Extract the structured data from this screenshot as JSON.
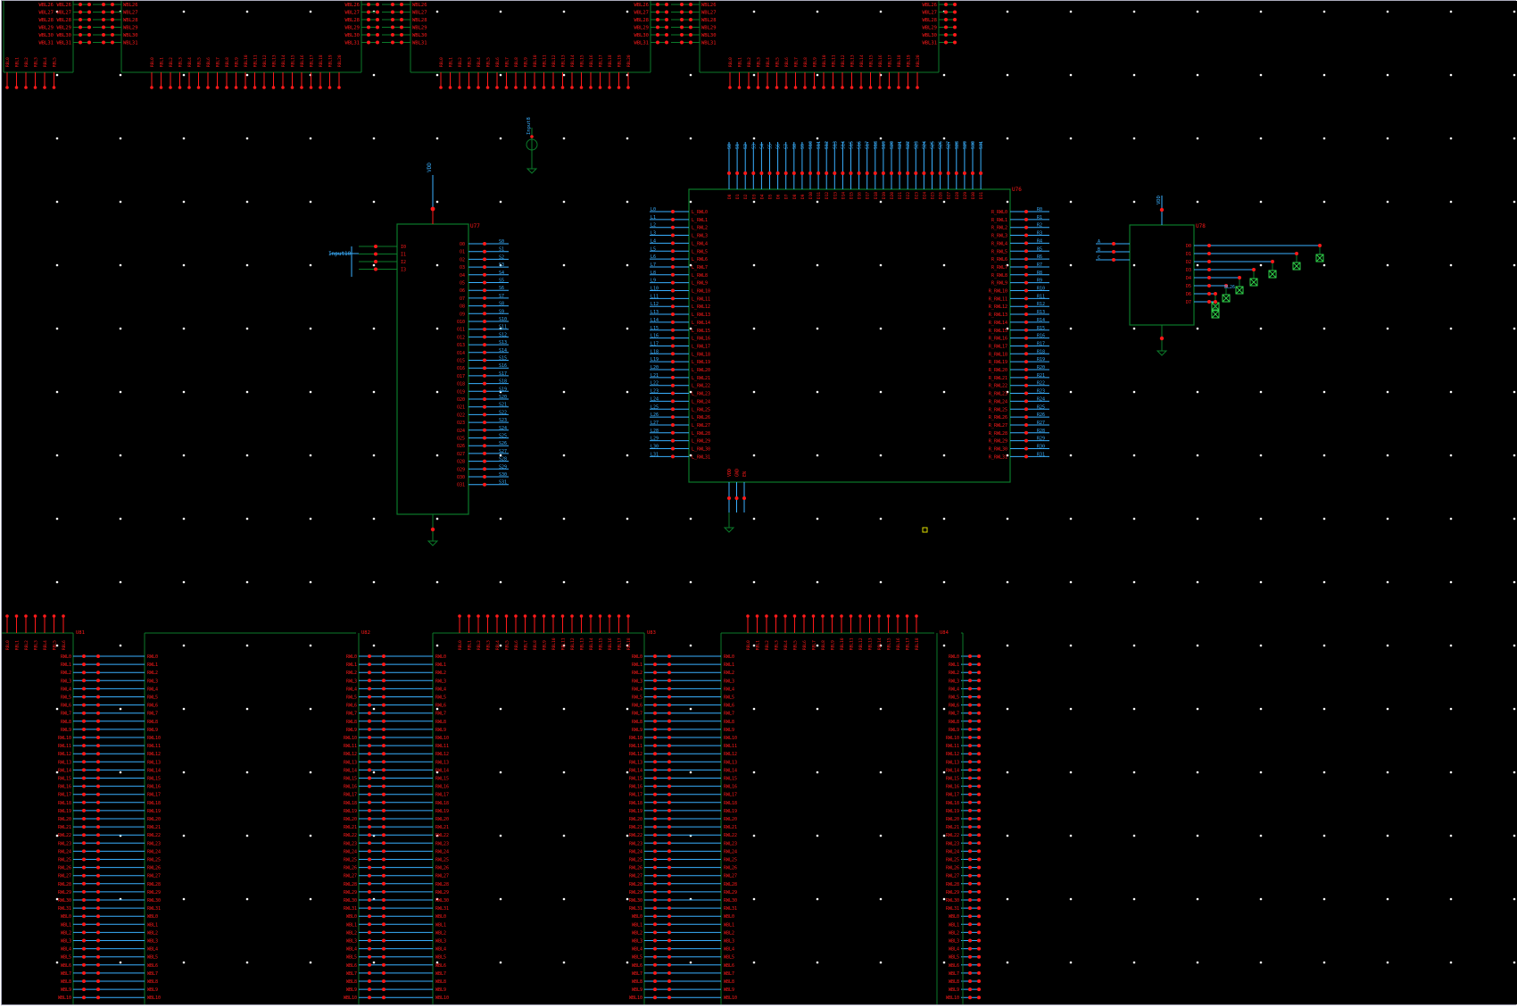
{
  "app": {
    "canvas": "schematic-editor-canvas",
    "background": "#000000"
  },
  "colors": {
    "wire": "#0b7a2a",
    "pin": "#ff1a1a",
    "net": "#3ab0ff",
    "grid": "#ffffff",
    "marker": "#e0e000"
  },
  "grid": {
    "cols": 25,
    "rows": 16
  },
  "top_blocks": [
    {
      "ref": "",
      "pins_left": [
        "WBL26",
        "WBL27",
        "WBL28",
        "WBL29",
        "WBL30",
        "WBL31"
      ],
      "pins_right": [
        "WBL26",
        "WBL27",
        "WBL28",
        "WBL29",
        "WBL30",
        "WBL31"
      ]
    },
    {
      "ref": "",
      "pins_left": [
        "WBL26",
        "WBL27",
        "WBL28",
        "WBL29",
        "WBL30",
        "WBL31"
      ],
      "pins_right": [
        "WBL26",
        "WBL27",
        "WBL28",
        "WBL29",
        "WBL30",
        "WBL31"
      ]
    },
    {
      "ref": "",
      "pins_left": [
        "WBL26",
        "WBL27",
        "WBL28",
        "WBL29",
        "WBL30",
        "WBL31"
      ],
      "pins_right": [
        "WBL26",
        "WBL27",
        "WBL28",
        "WBL29",
        "WBL30",
        "WBL31"
      ]
    },
    {
      "ref": "",
      "pins_left": [
        "WBL26",
        "WBL27",
        "WBL28",
        "WBL29",
        "WBL30",
        "WBL31"
      ],
      "pins_right": [
        "WBL26",
        "WBL27",
        "WBL28",
        "WBL29",
        "WBL30",
        "WBL31"
      ]
    }
  ],
  "u77": {
    "ref": "U77",
    "vdd_label": "VDD",
    "input_net": "Input10",
    "pins_left": [
      "I0",
      "I1",
      "I2",
      "I3"
    ],
    "pins_right": [
      "O0",
      "O1",
      "O2",
      "O3",
      "O4",
      "O5",
      "O6",
      "O7",
      "O8",
      "O9",
      "O10",
      "O11",
      "O12",
      "O13",
      "O14",
      "O15",
      "O16",
      "O17",
      "O18",
      "O19",
      "O20",
      "O21",
      "O22",
      "O23",
      "O24",
      "O25",
      "O26",
      "O27",
      "O28",
      "O29",
      "O30",
      "O31"
    ],
    "nets_right": [
      "S0",
      "S1",
      "S2",
      "S3",
      "S4",
      "S5",
      "S6",
      "S7",
      "S8",
      "S9",
      "S10",
      "S11",
      "S12",
      "S13",
      "S14",
      "S15",
      "S16",
      "S17",
      "S18",
      "S19",
      "S20",
      "S21",
      "S22",
      "S23",
      "S24",
      "S25",
      "S26",
      "S27",
      "S28",
      "S29",
      "S30",
      "S31"
    ],
    "gnd_label": "GND"
  },
  "input_source": {
    "label": "Input8"
  },
  "u76": {
    "ref": "U76",
    "top_nets": [
      "S0",
      "S1",
      "S2",
      "S3",
      "S4",
      "S5",
      "S6",
      "S7",
      "S8",
      "S9",
      "S10",
      "S11",
      "S12",
      "S13",
      "S14",
      "S15",
      "S16",
      "S17",
      "S18",
      "S19",
      "S20",
      "S21",
      "S22",
      "S23",
      "S24",
      "S25",
      "S26",
      "S27",
      "S28",
      "S29",
      "S30",
      "S31"
    ],
    "pins_left": [
      "L_RWL0",
      "L_RWL1",
      "L_RWL2",
      "L_RWL3",
      "L_RWL4",
      "L_RWL5",
      "L_RWL6",
      "L_RWL7",
      "L_RWL8",
      "L_RWL9",
      "L_RWL10",
      "L_RWL11",
      "L_RWL12",
      "L_RWL13",
      "L_RWL14",
      "L_RWL15",
      "L_RWL16",
      "L_RWL17",
      "L_RWL18",
      "L_RWL19",
      "L_RWL20",
      "L_RWL21",
      "L_RWL22",
      "L_RWL23",
      "L_RWL24",
      "L_RWL25",
      "L_RWL26",
      "L_RWL27",
      "L_RWL28",
      "L_RWL29",
      "L_RWL30",
      "L_RWL31"
    ],
    "nets_left": [
      "L0",
      "L1",
      "L2",
      "L3",
      "L4",
      "L5",
      "L6",
      "L7",
      "L8",
      "L9",
      "L10",
      "L11",
      "L12",
      "L13",
      "L14",
      "L15",
      "L16",
      "L17",
      "L18",
      "L19",
      "L20",
      "L21",
      "L22",
      "L23",
      "L24",
      "L25",
      "L26",
      "L27",
      "L28",
      "L29",
      "L30",
      "L31"
    ],
    "pins_right": [
      "R_RWL0",
      "R_RWL1",
      "R_RWL2",
      "R_RWL3",
      "R_RWL4",
      "R_RWL5",
      "R_RWL6",
      "R_RWL7",
      "R_RWL8",
      "R_RWL9",
      "R_RWL10",
      "R_RWL11",
      "R_RWL12",
      "R_RWL13",
      "R_RWL14",
      "R_RWL15",
      "R_RWL16",
      "R_RWL17",
      "R_RWL18",
      "R_RWL19",
      "R_RWL20",
      "R_RWL21",
      "R_RWL22",
      "R_RWL23",
      "R_RWL24",
      "R_RWL25",
      "R_RWL26",
      "R_RWL27",
      "R_RWL28",
      "R_RWL29",
      "R_RWL30",
      "R_RWL31"
    ],
    "nets_right": [
      "R0",
      "R1",
      "R2",
      "R3",
      "R4",
      "R5",
      "R6",
      "R7",
      "R8",
      "R9",
      "R10",
      "R11",
      "R12",
      "R13",
      "R14",
      "R15",
      "R16",
      "R17",
      "R18",
      "R19",
      "R20",
      "R21",
      "R22",
      "R23",
      "R24",
      "R25",
      "R26",
      "R27",
      "R28",
      "R29",
      "R30",
      "R31"
    ],
    "bottom_pins": [
      "VDD",
      "GND",
      "EN"
    ]
  },
  "u78": {
    "ref": "U78",
    "vdd_label": "VDD",
    "pins_left": [
      "A",
      "B",
      "C"
    ],
    "pins_right": [
      "D0",
      "D1",
      "D2",
      "D3",
      "D4",
      "D5",
      "D6",
      "D7"
    ],
    "net_label": "BL26",
    "gnd_label": "GND"
  },
  "bottom_blocks": [
    {
      "ref": "U81"
    },
    {
      "ref": "U82"
    },
    {
      "ref": "U83"
    },
    {
      "ref": "U84"
    }
  ],
  "bottom_block_pins": [
    "RWL0",
    "RWL1",
    "RWL2",
    "RWL3",
    "RWL4",
    "RWL5",
    "RWL6",
    "RWL7",
    "RWL8",
    "RWL9",
    "RWL10",
    "RWL11",
    "RWL12",
    "RWL13",
    "RWL14",
    "RWL15",
    "RWL16",
    "RWL17",
    "RWL18",
    "RWL19",
    "RWL20",
    "RWL21",
    "RWL22",
    "RWL23",
    "RWL24",
    "RWL25",
    "RWL26",
    "RWL27",
    "RWL28",
    "RWL29",
    "RWL30",
    "RWL31",
    "WBL0",
    "WBL1",
    "WBL2",
    "WBL3",
    "WBL4",
    "WBL5",
    "WBL6",
    "WBL7",
    "WBL8",
    "WBL9",
    "WBL10",
    "WBL11"
  ]
}
